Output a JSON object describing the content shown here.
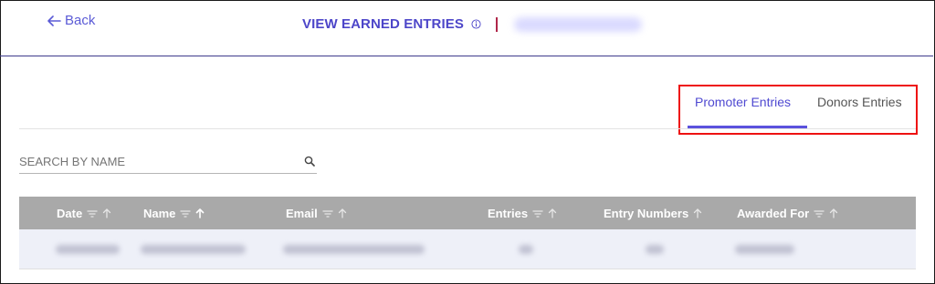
{
  "header": {
    "back_label": "Back",
    "title": "VIEW EARNED ENTRIES"
  },
  "tabs": [
    {
      "label": "Promoter Entries",
      "active": true
    },
    {
      "label": "Donors Entries",
      "active": false
    }
  ],
  "search": {
    "placeholder": "SEARCH BY NAME"
  },
  "table": {
    "columns": [
      "Date",
      "Name",
      "Email",
      "Entries",
      "Entry Numbers",
      "Awarded For"
    ]
  },
  "colors": {
    "accent": "#4d46c9",
    "header_bg": "#a9a9a9",
    "highlight_box": "#e11111"
  },
  "icons": {
    "back": "arrow-left-icon",
    "info": "info-circle-icon",
    "search": "search-icon",
    "sort": "filter-lines-icon",
    "arrow": "arrow-up-icon"
  }
}
